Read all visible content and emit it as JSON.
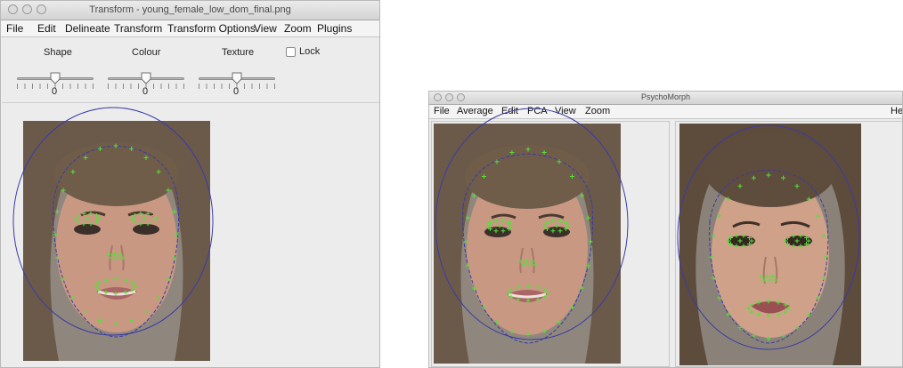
{
  "transform_window": {
    "title": "Transform - young_female_low_dom_final.png",
    "menu": [
      "File",
      "Edit",
      "Delineate",
      "Transform",
      "Transform Options",
      "View",
      "Zoom",
      "Plugins"
    ],
    "sliders": [
      {
        "label": "Shape",
        "value": 0
      },
      {
        "label": "Colour",
        "value": 0
      },
      {
        "label": "Texture",
        "value": 0
      }
    ],
    "lock_label": "Lock",
    "lock_checked": false
  },
  "psychomorph_window": {
    "title": "PsychoMorph",
    "menu": [
      "File",
      "Average",
      "Edit",
      "PCA",
      "View",
      "Zoom"
    ],
    "menu_right": "Hel"
  },
  "colors": {
    "outline": "#3a3aa8",
    "landmark": "#56e03a",
    "window_bg": "#ececec"
  }
}
